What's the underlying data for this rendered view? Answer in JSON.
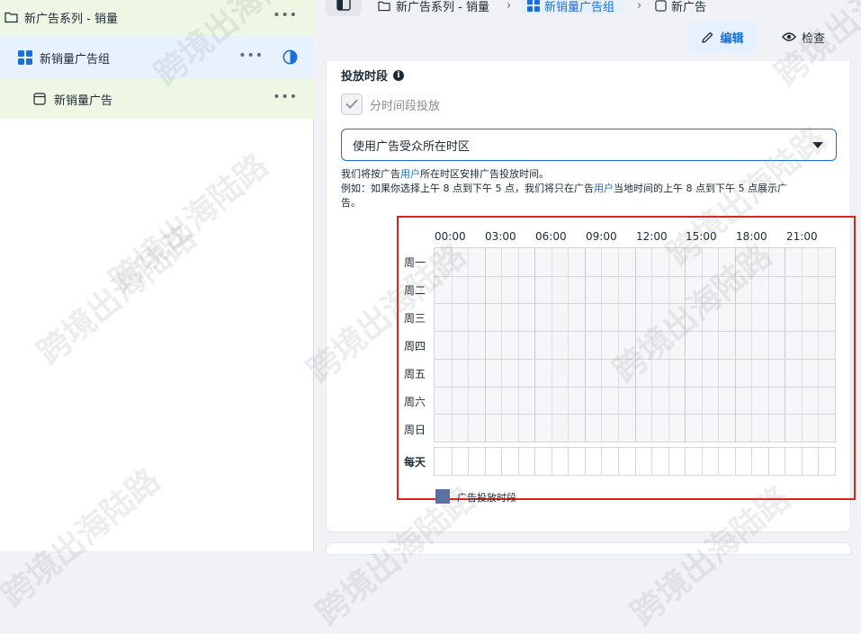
{
  "tree": {
    "campaign": {
      "label": "新广告系列 - 销量",
      "more": "•••"
    },
    "adset": {
      "label": "新销量广告组",
      "more": "•••"
    },
    "ad": {
      "label": "新销量广告",
      "more": "•••"
    }
  },
  "breadcrumb": {
    "items": [
      "新广告系列 - 销量",
      "新销量广告组",
      "新广告"
    ],
    "separator": "›"
  },
  "actions": {
    "edit_label": "编辑",
    "inspect_label": "检查"
  },
  "schedule": {
    "section_title": "投放时段",
    "info": "i",
    "dayparting_label": "分时间段投放",
    "timezone_select": "使用广告受众所在时区",
    "help": {
      "line1_a": "我们将按广告",
      "line1_link": "用户",
      "line1_b": "所在时区安排广告投放时间。",
      "line2_a": "例如：如果你选择上午 8 点到下午 5 点，我们将只在广告",
      "line2_link": "用户",
      "line2_b": "当地时间的上午 8 点到下午 5 点展示广",
      "line3": "告。"
    },
    "hours": [
      "00:00",
      "03:00",
      "06:00",
      "09:00",
      "12:00",
      "15:00",
      "18:00",
      "21:00"
    ],
    "days": [
      "周一",
      "周二",
      "周三",
      "周四",
      "周五",
      "周六",
      "周日"
    ],
    "everyday_label": "每天",
    "legend_label": "广告投放时段",
    "legend_color": "#5b6fa3"
  },
  "colors": {
    "accent": "#1a6fd9",
    "highlight": "#e0201b",
    "tree_green": "#eef6e4",
    "tree_blue": "#e8f2ff"
  },
  "watermark": "跨境出海陆路"
}
